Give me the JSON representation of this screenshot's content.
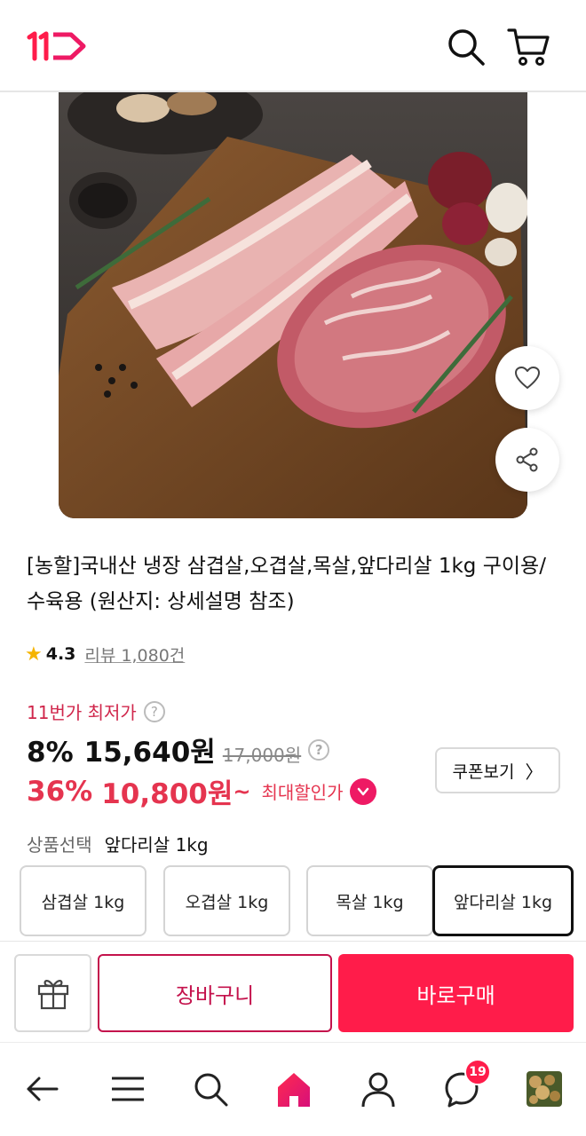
{
  "colors": {
    "brand": "#ff1c4a",
    "cart_border": "#c4124c",
    "coupon_red": "#e5344f",
    "lowest_label": "#d0264b",
    "star": "#f5b400"
  },
  "header": {
    "logo_icon": "11st-logo-icon",
    "search_icon": "search-icon",
    "cart_icon": "cart-icon"
  },
  "product": {
    "image_icon": "product-photo",
    "title": "[농할]국내산 냉장 삼겹살,오겹살,목살,앞다리살 1kg 구이용/수육용 (원산지: 상세설명 참조)",
    "rating": "4.3",
    "review_label": "리뷰 1,080건"
  },
  "price": {
    "lowest_label": "11번가 최저가",
    "help_mark": "?",
    "discount_pct": "8%",
    "sale_price": "15,640원",
    "original_price": "17,000원",
    "coupon_pct": "36%",
    "coupon_price": "10,800원",
    "tilde": "~",
    "max_discount_label": "최대할인가",
    "coupon_button": "쿠폰보기",
    "coupon_chevron": "〉"
  },
  "options": {
    "label": "상품선택",
    "selected": "앞다리살 1kg",
    "items": [
      "삼겹살 1kg",
      "오겹살 1kg",
      "목살 1kg",
      "앞다리살 1kg"
    ]
  },
  "actions": {
    "gift_icon": "gift-icon",
    "cart_label": "장바구니",
    "buy_label": "바로구매"
  },
  "bottom_nav": {
    "items": [
      "back-icon",
      "menu-icon",
      "search-icon",
      "home-icon",
      "person-icon",
      "chat-icon",
      "recent-item-thumbnail"
    ],
    "chat_badge": "19"
  }
}
